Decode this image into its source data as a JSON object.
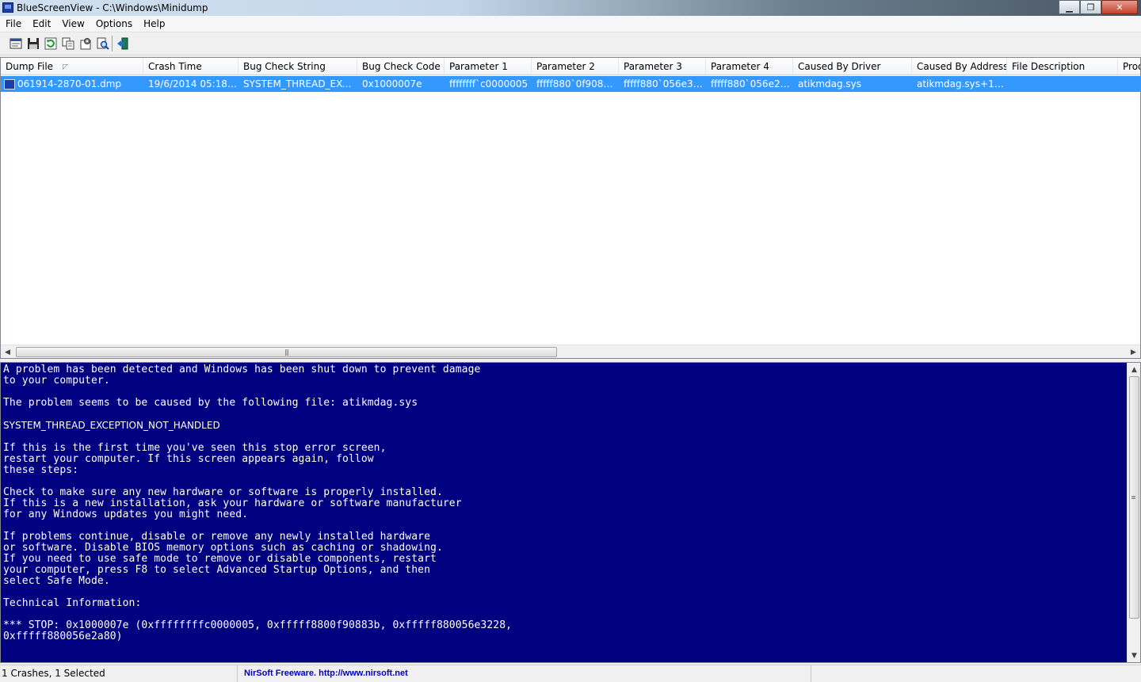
{
  "window": {
    "title": "BlueScreenView  -  C:\\Windows\\Minidump",
    "minimize_glyph": "▁",
    "maximize_glyph": "❐",
    "close_glyph": "✕"
  },
  "menu": [
    "File",
    "Edit",
    "View",
    "Options",
    "Help"
  ],
  "toolbar": {
    "icons": [
      "properties-icon",
      "save-icon",
      "refresh-icon",
      "copy-icon",
      "options-icon",
      "search-icon",
      "exit-icon"
    ]
  },
  "table": {
    "columns": [
      "Dump File",
      "Crash Time",
      "Bug Check String",
      "Bug Check Code",
      "Parameter 1",
      "Parameter 2",
      "Parameter 3",
      "Parameter 4",
      "Caused By Driver",
      "Caused By Address",
      "File Description",
      "Prod"
    ],
    "rows": [
      {
        "dump_file": "061914-2870-01.dmp",
        "crash_time": "19/6/2014 05:18:...",
        "bug_check_string": "SYSTEM_THREAD_EXC...",
        "bug_check_code": "0x1000007e",
        "parameter_1": "ffffffff`c0000005",
        "parameter_2": "fffff880`0f90883b",
        "parameter_3": "fffff880`056e32...",
        "parameter_4": "fffff880`056e2a...",
        "caused_by_driver": "atikmdag.sys",
        "caused_by_address": "atikmdag.sys+12...",
        "file_description": "",
        "product": ""
      }
    ],
    "selected_row_color": "#3399ff"
  },
  "bsod": {
    "background": "#000080",
    "line_1": "A problem has been detected and Windows has been shut down to prevent damage",
    "line_2": "to your computer.",
    "line_3": "The problem seems to be caused by the following file: atikmdag.sys",
    "bug_name": "SYSTEM_THREAD_EXCEPTION_NOT_HANDLED",
    "para_1": [
      "If this is the first time you've seen this stop error screen,",
      "restart your computer. If this screen appears again, follow",
      "these steps:"
    ],
    "para_2": [
      "Check to make sure any new hardware or software is properly installed.",
      "If this is a new installation, ask your hardware or software manufacturer",
      "for any Windows updates you might need."
    ],
    "para_3": [
      "If problems continue, disable or remove any newly installed hardware",
      "or software. Disable BIOS memory options such as caching or shadowing.",
      "If you need to use safe mode to remove or disable components, restart",
      "your computer, press F8 to select Advanced Startup Options, and then",
      "select Safe Mode."
    ],
    "tech_header": "Technical Information:",
    "stop_line_1": "*** STOP: 0x1000007e (0xffffffffc0000005, 0xfffff8800f90883b, 0xfffff880056e3228,",
    "stop_line_2": "0xfffff880056e2a80)"
  },
  "status": {
    "summary": "1 Crashes, 1 Selected",
    "credit": "NirSoft Freeware.  http://www.nirsoft.net"
  }
}
